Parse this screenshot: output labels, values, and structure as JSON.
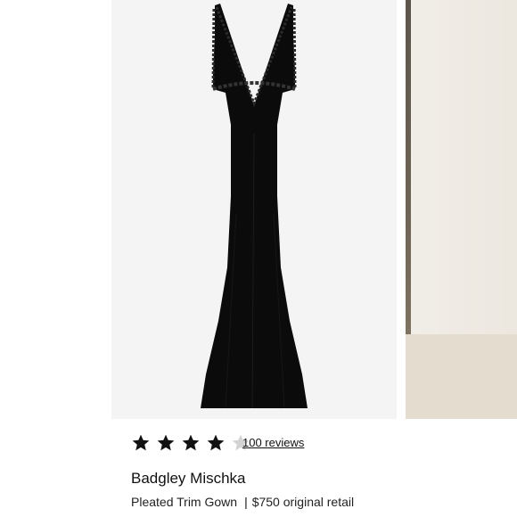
{
  "product": {
    "brand": "Badgley Mischka",
    "name": "Pleated Trim Gown",
    "separator": "|",
    "retail": "$750 original retail",
    "image_icon": "black-gown-image"
  },
  "rating": {
    "value": 4,
    "max": 5,
    "reviews_label": "100 reviews",
    "filled_color": "#111111",
    "empty_color": "#d3d3d3"
  },
  "colors": {
    "gown": "#0b0b0b",
    "photo_bg": "#f4f4f4"
  }
}
